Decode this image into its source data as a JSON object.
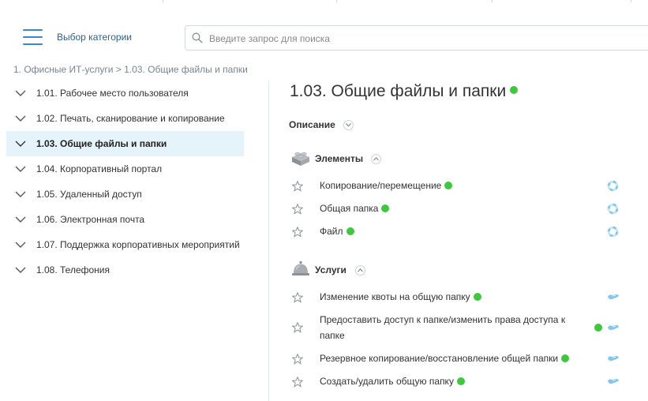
{
  "header": {
    "menu_label": "Выбор категории",
    "search_placeholder": "Введите запрос для поиска"
  },
  "breadcrumb": "1. Офисные ИТ-услуги > 1.03. Общие файлы и папки",
  "sidebar": {
    "items": [
      {
        "label": "1.01. Рабочее место пользователя"
      },
      {
        "label": "1.02. Печать, сканирование и копирование"
      },
      {
        "label": "1.03. Общие файлы и папки"
      },
      {
        "label": "1.04. Корпоративный портал"
      },
      {
        "label": "1.05. Удаленный доступ"
      },
      {
        "label": "1.06. Электронная почта"
      },
      {
        "label": "1.07. Поддержка корпоративных мероприятий"
      },
      {
        "label": "1.08. Телефония"
      }
    ],
    "active_index": 2
  },
  "main": {
    "title": "1.03. Общие файлы и папки",
    "description_label": "Описание",
    "elements": {
      "title": "Элементы",
      "items": [
        {
          "label": "Копирование/перемещение"
        },
        {
          "label": "Общая папка"
        },
        {
          "label": "Файл"
        }
      ]
    },
    "services": {
      "title": "Услуги",
      "items": [
        {
          "label": "Изменение квоты на общую папку"
        },
        {
          "label": "Предоставить доступ к папке/изменить права доступа к папке"
        },
        {
          "label": "Резервное копирование/восстановление общей папки"
        },
        {
          "label": "Создать/удалить общую папку"
        }
      ]
    }
  },
  "colors": {
    "accent_blue": "#3a86d1",
    "status_green": "#3cc93c",
    "active_bg": "#e5f3fb",
    "action_icon": "#82c8ec"
  },
  "icons": {
    "menu": "hamburger-icon",
    "search": "search-icon",
    "chevron": "chevron-down-icon",
    "star": "star-icon",
    "elements": "blocks-icon",
    "services": "service-bell-icon",
    "element_action": "lifebuoy-icon",
    "service_action": "request-icon"
  }
}
